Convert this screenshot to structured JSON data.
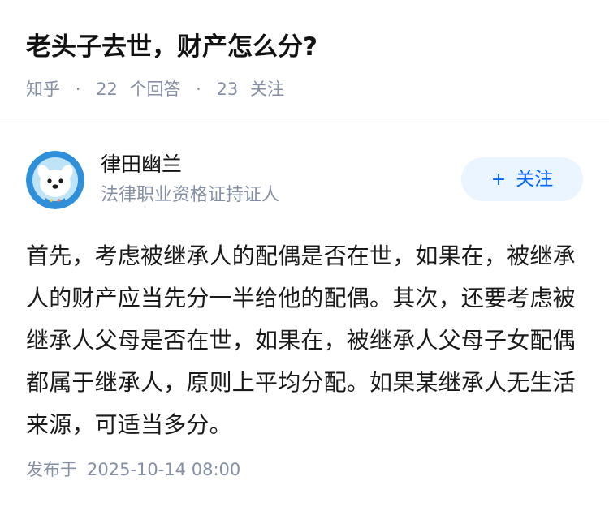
{
  "question": {
    "title": "老头子去世，财产怎么分?",
    "source": "知乎",
    "answer_count": "22",
    "answer_unit": "个回答",
    "follower_count": "23",
    "follower_unit": "关注"
  },
  "author": {
    "name": "律田幽兰",
    "badge": "法律职业资格证持证人",
    "avatar_icon": "dog-astronaut-avatar",
    "follow_label": "关注",
    "follow_icon": "plus-icon"
  },
  "answer": {
    "content": "首先，考虑被继承人的配偶是否在世，如果在，被继承人的财产应当先分一半给他的配偶。其次，还要考虑被继承人父母是否在世，如果在，被继承人父母子女配偶都属于继承人，原则上平均分配。如果某继承人无生活来源，可适当多分。"
  },
  "publish": {
    "label": "发布于",
    "time": "2025-10-14 08:00"
  },
  "colors": {
    "accent": "#0066ff",
    "follow_bg": "#ebf5ff",
    "meta_gray": "#8590a6",
    "text": "#121212"
  }
}
